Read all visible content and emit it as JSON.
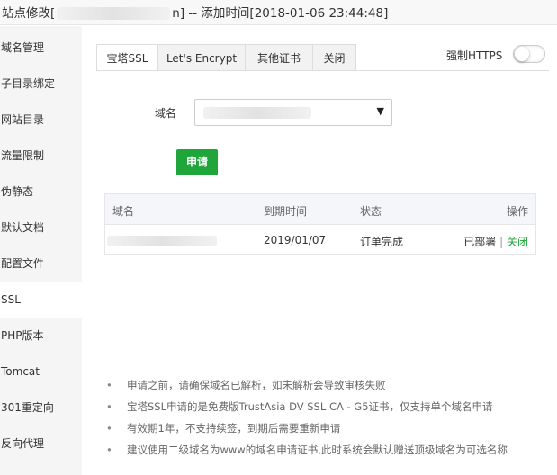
{
  "title": {
    "prefix": "站点修改[",
    "suffix": "n] -- 添加时间[2018-01-06 23:44:48]"
  },
  "sidebar": {
    "items": [
      {
        "label": "域名管理"
      },
      {
        "label": "子目录绑定"
      },
      {
        "label": "网站目录"
      },
      {
        "label": "流量限制"
      },
      {
        "label": "伪静态"
      },
      {
        "label": "默认文档"
      },
      {
        "label": "配置文件"
      },
      {
        "label": "SSL"
      },
      {
        "label": "PHP版本"
      },
      {
        "label": "Tomcat"
      },
      {
        "label": "301重定向"
      },
      {
        "label": "反向代理"
      }
    ],
    "active_index": 7
  },
  "tabs": [
    {
      "label": "宝塔SSL"
    },
    {
      "label": "Let's Encrypt"
    },
    {
      "label": "其他证书"
    },
    {
      "label": "关闭"
    }
  ],
  "force_https": {
    "label": "强制HTTPS",
    "enabled": false
  },
  "form": {
    "domain_label": "域名",
    "apply_label": "申请",
    "accent": "#20a53a"
  },
  "table": {
    "headers": {
      "domain": "域名",
      "expire": "到期时间",
      "status": "状态",
      "action": "操作"
    },
    "rows": [
      {
        "expire": "2019/01/07",
        "status": "订单完成",
        "deployed": "已部署",
        "separator": " | ",
        "close": "关闭"
      }
    ]
  },
  "notes": [
    "申请之前，请确保域名已解析，如未解析会导致审核失败",
    "宝塔SSL申请的是免费版TrustAsia DV SSL CA - G5证书，仅支持单个域名申请",
    "有效期1年，不支持续签，到期后需要重新申请",
    "建议使用二级域名为www的域名申请证书,此时系统会默认赠送顶级域名为可选名称"
  ]
}
